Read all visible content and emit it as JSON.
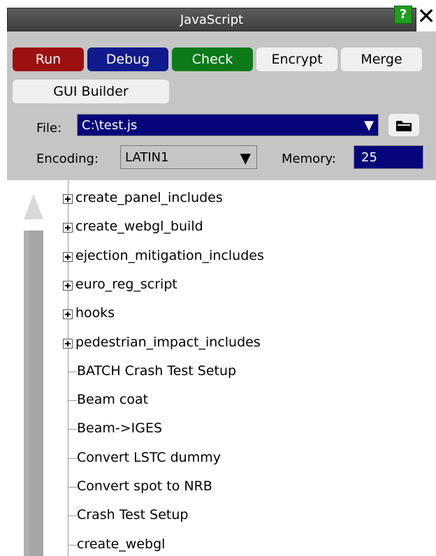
{
  "window": {
    "title": "JavaScript",
    "help_label": "?",
    "close_label": "✕"
  },
  "toolbar": {
    "run": "Run",
    "debug": "Debug",
    "check": "Check",
    "encrypt": "Encrypt",
    "merge": "Merge",
    "gui_builder": "GUI Builder"
  },
  "file": {
    "label": "File:",
    "value": "C:\\test.js",
    "arrow": "▼"
  },
  "encoding": {
    "label": "Encoding:",
    "value": "LATIN1",
    "arrow": "▼"
  },
  "memory": {
    "label": "Memory:",
    "value": "25"
  },
  "tree": {
    "items": [
      {
        "label": "create_panel_includes",
        "type": "folder"
      },
      {
        "label": "create_webgl_build",
        "type": "folder"
      },
      {
        "label": "ejection_mitigation_includes",
        "type": "folder"
      },
      {
        "label": "euro_reg_script",
        "type": "folder"
      },
      {
        "label": "hooks",
        "type": "folder"
      },
      {
        "label": "pedestrian_impact_includes",
        "type": "folder"
      },
      {
        "label": "BATCH Crash Test Setup",
        "type": "leaf"
      },
      {
        "label": "Beam coat",
        "type": "leaf"
      },
      {
        "label": "Beam->IGES",
        "type": "leaf"
      },
      {
        "label": "Convert LSTC dummy",
        "type": "leaf"
      },
      {
        "label": "Convert spot to NRB",
        "type": "leaf"
      },
      {
        "label": "Crash Test Setup",
        "type": "leaf"
      },
      {
        "label": "create_webgl",
        "type": "leaf"
      }
    ]
  },
  "colors": {
    "run": "#9d1010",
    "debug": "#101a8c",
    "check": "#0c7a18",
    "field_blue": "#06067a",
    "panel": "#c5c5c5"
  }
}
